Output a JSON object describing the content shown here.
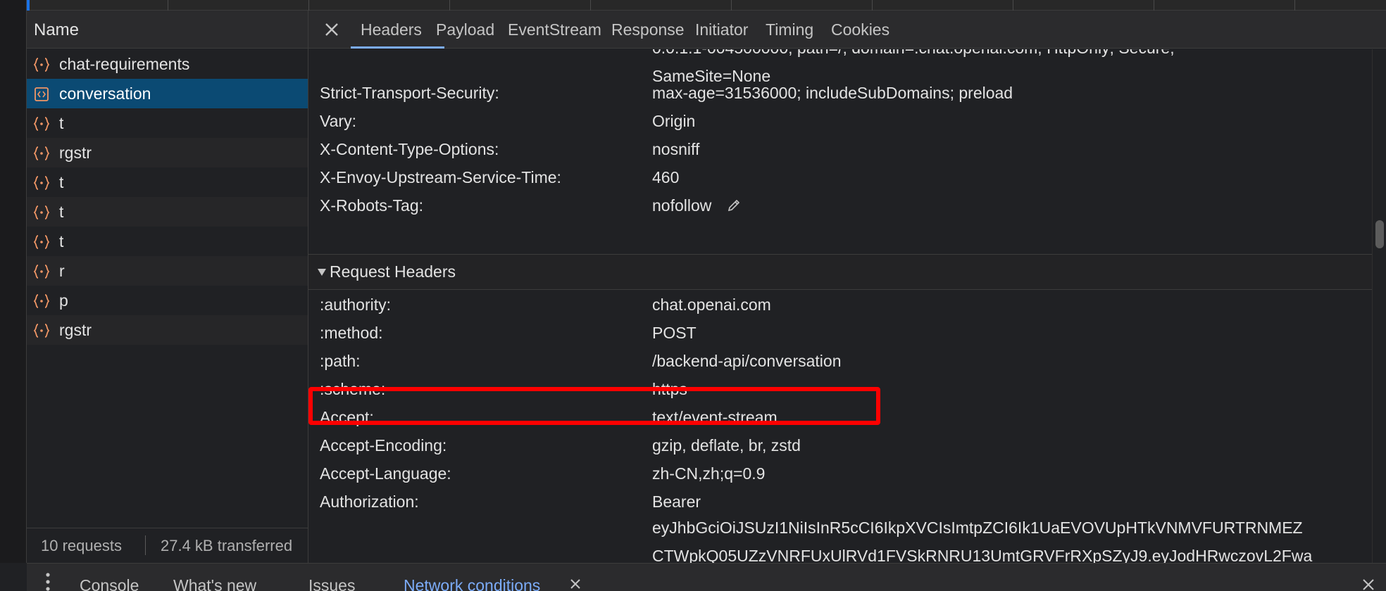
{
  "request_list": {
    "column_header": "Name",
    "items": [
      {
        "name": "chat-requirements",
        "icon": "fetch-brace-icon"
      },
      {
        "name": "conversation",
        "icon": "document-icon",
        "selected": true
      },
      {
        "name": "t",
        "icon": "fetch-brace-icon"
      },
      {
        "name": "rgstr",
        "icon": "fetch-brace-icon"
      },
      {
        "name": "t",
        "icon": "fetch-brace-icon"
      },
      {
        "name": "t",
        "icon": "fetch-brace-icon"
      },
      {
        "name": "t",
        "icon": "fetch-brace-icon"
      },
      {
        "name": "r",
        "icon": "fetch-brace-icon"
      },
      {
        "name": "p",
        "icon": "fetch-brace-icon"
      },
      {
        "name": "rgstr",
        "icon": "fetch-brace-icon"
      }
    ],
    "footer": {
      "requests": "10 requests",
      "transferred": "27.4 kB transferred"
    }
  },
  "details": {
    "tabs": [
      "Headers",
      "Payload",
      "EventStream",
      "Response",
      "Initiator",
      "Timing",
      "Cookies"
    ],
    "active_tab": "Headers",
    "partial_lines": [
      "0.0.1.1-004500000; path=/; domain=.chat.openai.com; HttpOnly; Secure;",
      "SameSite=None"
    ],
    "response_headers": [
      {
        "key": "Strict-Transport-Security:",
        "value": "max-age=31536000; includeSubDomains; preload"
      },
      {
        "key": "Vary:",
        "value": "Origin"
      },
      {
        "key": "X-Content-Type-Options:",
        "value": "nosniff"
      },
      {
        "key": "X-Envoy-Upstream-Service-Time:",
        "value": "460"
      },
      {
        "key": "X-Robots-Tag:",
        "value": "nofollow"
      }
    ],
    "request_headers_title": "Request Headers",
    "request_headers": [
      {
        "key": ":authority:",
        "value": "chat.openai.com"
      },
      {
        "key": ":method:",
        "value": "POST"
      },
      {
        "key": ":path:",
        "value": "/backend-api/conversation"
      },
      {
        "key": ":scheme:",
        "value": "https"
      },
      {
        "key": "Accept:",
        "value": "text/event-stream",
        "highlighted": true
      },
      {
        "key": "Accept-Encoding:",
        "value": "gzip, deflate, br, zstd"
      },
      {
        "key": "Accept-Language:",
        "value": "zh-CN,zh;q=0.9"
      },
      {
        "key": "Authorization:",
        "value": "Bearer"
      }
    ],
    "authorization_token_lines": [
      "eyJhbGciOiJSUzI1NiIsInR5cCI6IkpXVCIsImtpZCI6Ik1UaEVOVUpHTkVNMVFURTRNMEZ",
      "CTWpkQ05UZzVNRFUxUlRVd1FVSkRNRU13UmtGRVFrRXpSZyJ9.eyJodHRwczovL2Fwa"
    ]
  },
  "drawer": {
    "tabs": [
      "Console",
      "What's new",
      "Issues",
      "Network conditions"
    ],
    "active_tab": "Network conditions"
  },
  "colors": {
    "accent": "#7cacf8",
    "selected_row": "#0b4a73",
    "highlight_box": "#ff0000",
    "fetch_icon": "#f29766",
    "document_icon": "#f29766"
  }
}
